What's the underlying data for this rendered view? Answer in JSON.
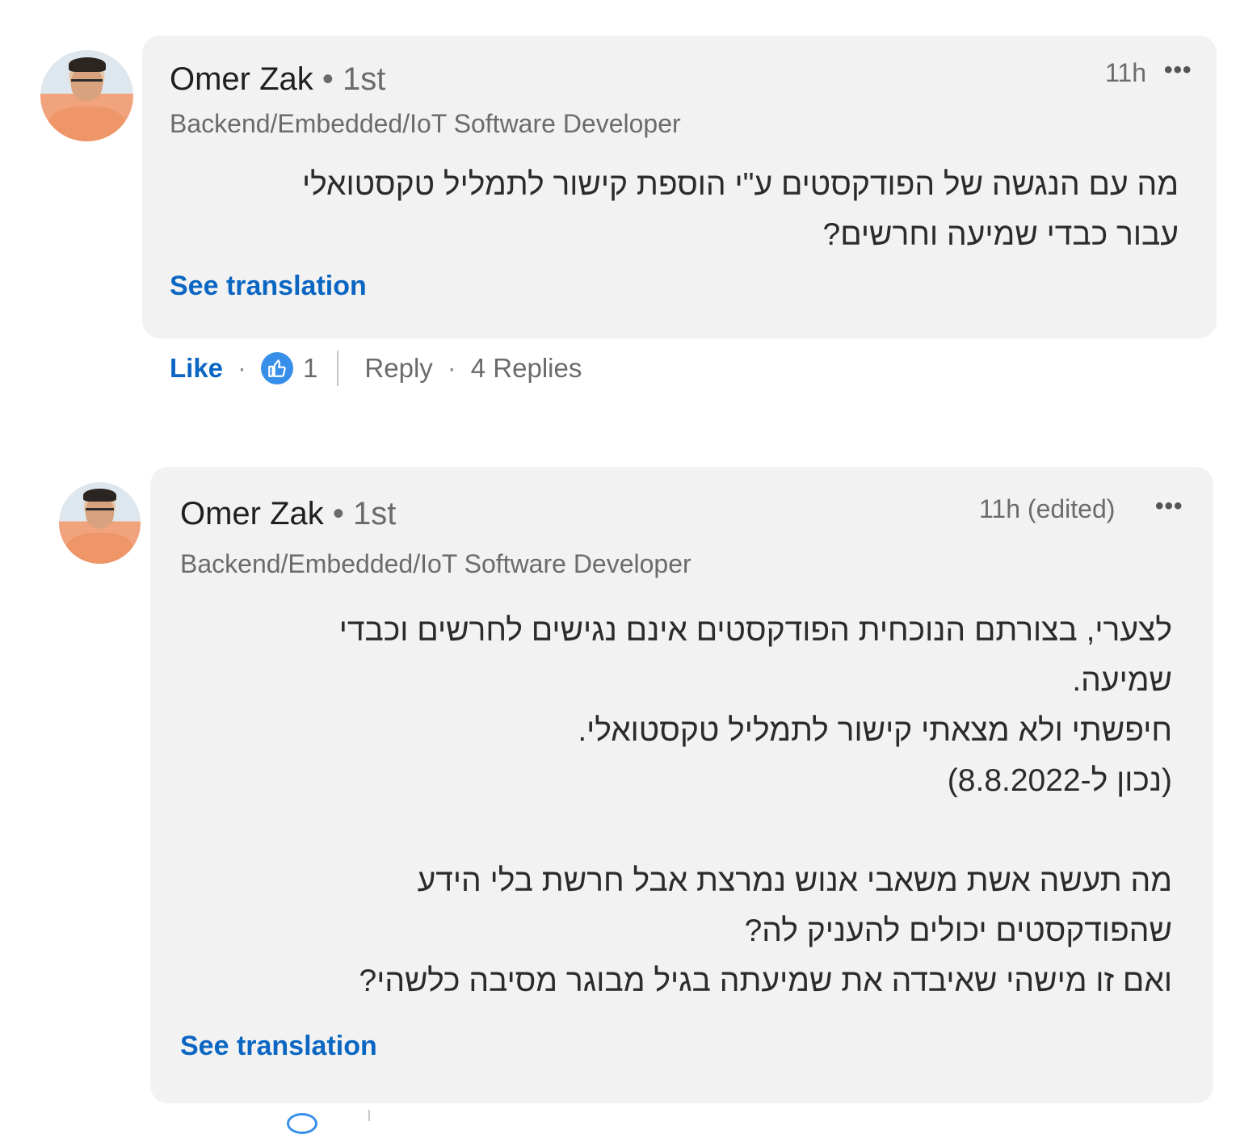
{
  "comments": [
    {
      "author": "Omer Zak",
      "degree": "• 1st",
      "headline": "Backend/Embedded/IoT Software Developer",
      "time": "11h",
      "more_icon": "more-horizontal-icon",
      "body_lines": [
        "מה עם הנגשה של הפודקסטים ע\"י הוספת קישור לתמליל טקסטואלי",
        "עבור כבדי שמיעה וחרשים?"
      ],
      "see_translation": "See translation",
      "actions": {
        "like": "Like",
        "dot": "·",
        "reaction_icon": "thumbs-up-icon",
        "reaction_count": "1",
        "reply": "Reply",
        "replies_dot": "·",
        "replies": "4 Replies"
      }
    },
    {
      "author": "Omer Zak",
      "degree": "• 1st",
      "headline": "Backend/Embedded/IoT Software Developer",
      "time": "11h (edited)",
      "more_icon": "more-horizontal-icon",
      "body_lines": [
        "לצערי, בצורתם הנוכחית הפודקסטים אינם נגישים לחרשים וכבדי",
        "שמיעה.",
        "חיפשתי ולא מצאתי קישור לתמליל טקסטואלי.",
        "(נכון ל-8.8.2022)",
        "",
        "מה תעשה אשת משאבי אנוש נמרצת אבל חרשת בלי הידע",
        "שהפודקסטים יכולים להעניק לה?",
        "ואם זו מישהי שאיבדה את שמיעתה בגיל מבוגר מסיבה כלשהי?"
      ],
      "see_translation": "See translation"
    }
  ],
  "colors": {
    "link": "#0a66c2",
    "bubble": "#f2f2f2",
    "reaction": "#378fe9"
  }
}
